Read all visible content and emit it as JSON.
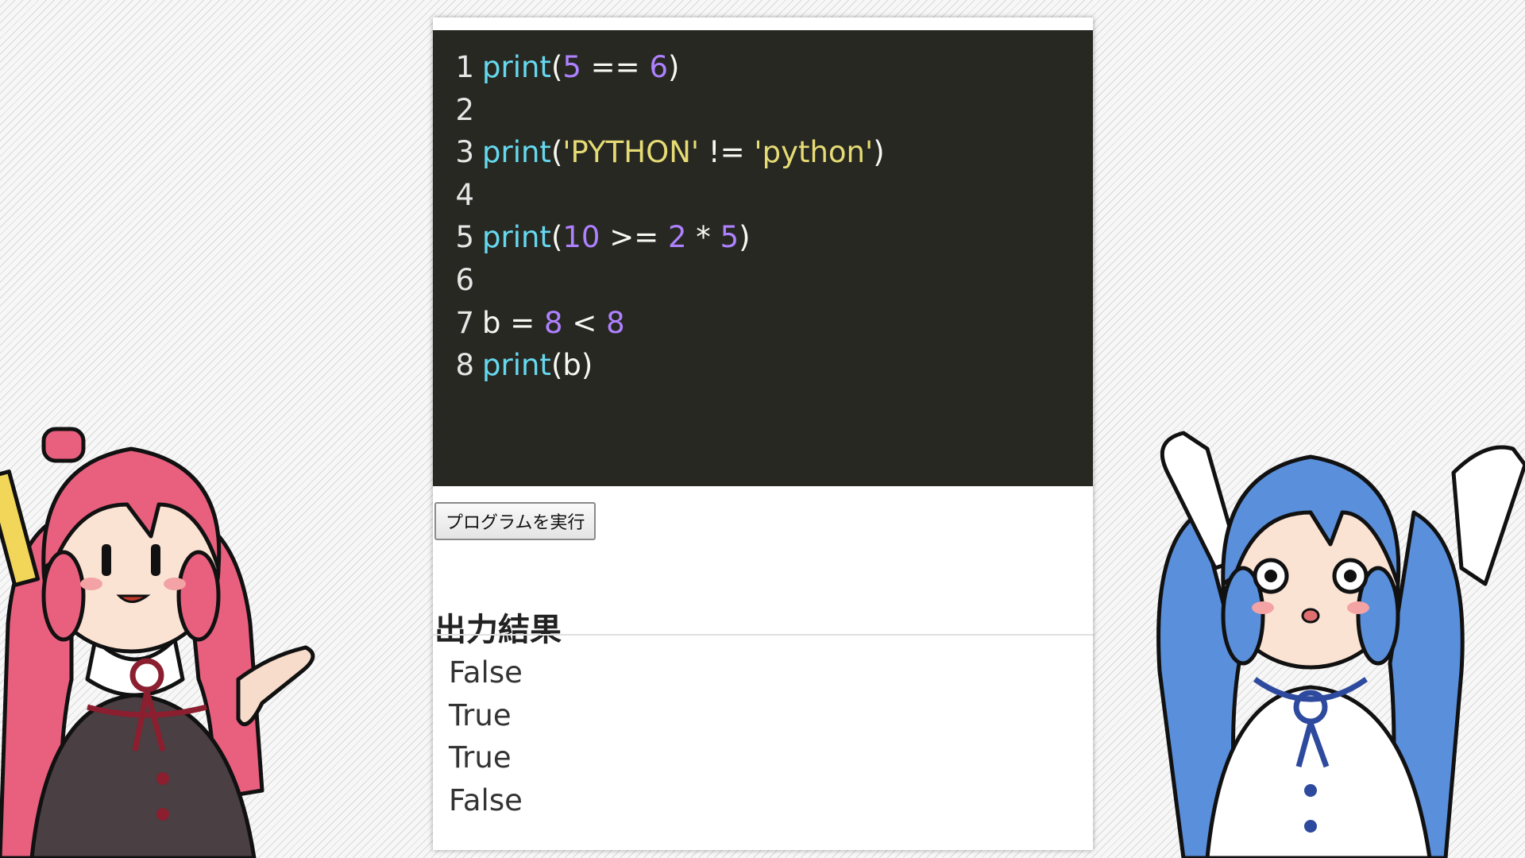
{
  "editor": {
    "lines": [
      {
        "number": "1",
        "tokens": [
          [
            "fn",
            "print"
          ],
          [
            "txt",
            "("
          ],
          [
            "num",
            "5"
          ],
          [
            "txt",
            " == "
          ],
          [
            "num",
            "6"
          ],
          [
            "txt",
            ")"
          ]
        ]
      },
      {
        "number": "2",
        "tokens": []
      },
      {
        "number": "3",
        "tokens": [
          [
            "fn",
            "print"
          ],
          [
            "txt",
            "("
          ],
          [
            "str",
            "'PYTHON'"
          ],
          [
            "txt",
            " != "
          ],
          [
            "str",
            "'python'"
          ],
          [
            "txt",
            ")"
          ]
        ]
      },
      {
        "number": "4",
        "tokens": []
      },
      {
        "number": "5",
        "tokens": [
          [
            "fn",
            "print"
          ],
          [
            "txt",
            "("
          ],
          [
            "num",
            "10"
          ],
          [
            "txt",
            " >= "
          ],
          [
            "num",
            "2"
          ],
          [
            "txt",
            " * "
          ],
          [
            "num",
            "5"
          ],
          [
            "txt",
            ")"
          ]
        ]
      },
      {
        "number": "6",
        "tokens": []
      },
      {
        "number": "7",
        "tokens": [
          [
            "txt",
            "b = "
          ],
          [
            "num",
            "8"
          ],
          [
            "txt",
            " < "
          ],
          [
            "num",
            "8"
          ]
        ]
      },
      {
        "number": "8",
        "tokens": [
          [
            "fn",
            "print"
          ],
          [
            "txt",
            "(b)"
          ]
        ]
      }
    ]
  },
  "run_button_label": "プログラムを実行",
  "output": {
    "title": "出力結果",
    "lines": [
      "False",
      "True",
      "True",
      "False"
    ]
  },
  "colors": {
    "editor_bg": "#272822",
    "function": "#66d9ef",
    "number": "#ae81ff",
    "string": "#e6db74",
    "text": "#f8f8f2"
  }
}
